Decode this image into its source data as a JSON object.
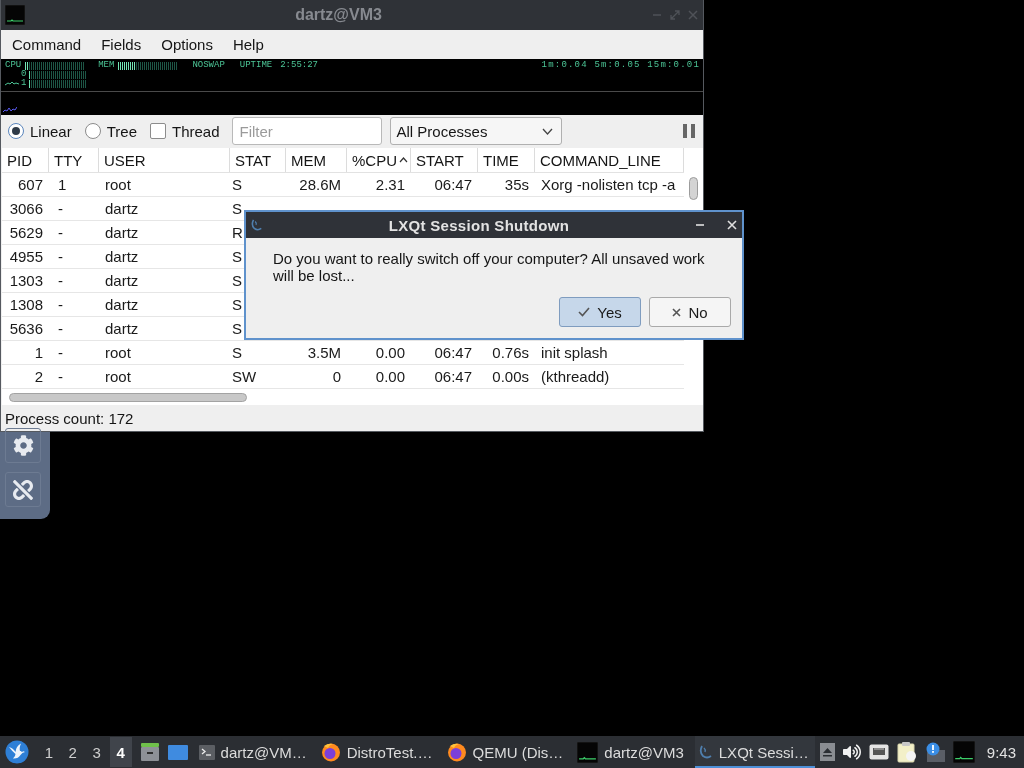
{
  "window": {
    "title": "dartz@VM3",
    "menu": [
      "Command",
      "Fields",
      "Options",
      "Help"
    ]
  },
  "meters": {
    "cpu": {
      "label": "CPU",
      "level": 0.05
    },
    "mem": {
      "label": "MEM",
      "level": 0.28
    },
    "swap": "NOSWAP",
    "uptime": {
      "label": "UPTIME",
      "value": "2:55:27"
    },
    "load": "1m:0.04 5m:0.05 15m:0.01",
    "cores": [
      {
        "label": "0",
        "level": 0.03
      },
      {
        "label": "1",
        "level": 0.03
      }
    ]
  },
  "toolbar": {
    "modes": [
      {
        "label": "Linear",
        "selected": true
      },
      {
        "label": "Tree",
        "selected": false
      }
    ],
    "thread": {
      "label": "Thread",
      "checked": false
    },
    "filter": {
      "placeholder": "Filter"
    },
    "scope": {
      "value": "All Processes"
    }
  },
  "table": {
    "columns": [
      {
        "label": "PID",
        "sorted": false
      },
      {
        "label": "TTY",
        "sorted": false
      },
      {
        "label": "USER",
        "sorted": false
      },
      {
        "label": "STAT",
        "sorted": false
      },
      {
        "label": "MEM",
        "sorted": false
      },
      {
        "label": "%CPU",
        "sorted": true
      },
      {
        "label": "START",
        "sorted": false
      },
      {
        "label": "TIME",
        "sorted": false
      },
      {
        "label": "COMMAND_LINE",
        "sorted": false
      }
    ],
    "rows": [
      [
        "607",
        "1",
        "root",
        "S",
        "28.6M",
        "2.31",
        "06:47",
        "35s",
        "Xorg -nolisten tcp -a"
      ],
      [
        "3066",
        "-",
        "dartz",
        "S"
      ],
      [
        "5629",
        "-",
        "dartz",
        "R"
      ],
      [
        "4955",
        "-",
        "dartz",
        "S"
      ],
      [
        "1303",
        "-",
        "dartz",
        "S"
      ],
      [
        "1308",
        "-",
        "dartz",
        "S"
      ],
      [
        "5636",
        "-",
        "dartz",
        "S"
      ],
      [
        "1",
        "-",
        "root",
        "S",
        "3.5M",
        "0.00",
        "06:47",
        "0.76s",
        "init splash"
      ],
      [
        "2",
        "-",
        "root",
        "SW",
        "0",
        "0.00",
        "06:47",
        "0.00s",
        "(kthreadd)"
      ]
    ]
  },
  "status_bar": "Process count: 172",
  "dialog": {
    "title": "LXQt Session Shutdown",
    "message": "Do you want to really switch off your computer? All unsaved work will be lost...",
    "buttons": [
      {
        "label": "Yes",
        "kind": "confirm",
        "default": true
      },
      {
        "label": "No",
        "kind": "cancel",
        "default": false
      }
    ]
  },
  "taskbar": {
    "desktops": [
      {
        "label": "1",
        "selected": false
      },
      {
        "label": "2",
        "selected": false
      },
      {
        "label": "3",
        "selected": false
      },
      {
        "label": "4",
        "selected": true
      }
    ],
    "tasks": [
      {
        "label": "dartz@VM…",
        "kind": "terminal",
        "selected": false
      },
      {
        "label": "DistroTest.…",
        "kind": "browser",
        "selected": false
      },
      {
        "label": "QEMU (Dis…",
        "kind": "browser",
        "selected": false
      },
      {
        "label": "dartz@VM3",
        "kind": "monitor",
        "selected": false
      },
      {
        "label": "LXQt Sessi…",
        "kind": "session",
        "selected": true
      }
    ],
    "clock": "9:43"
  }
}
